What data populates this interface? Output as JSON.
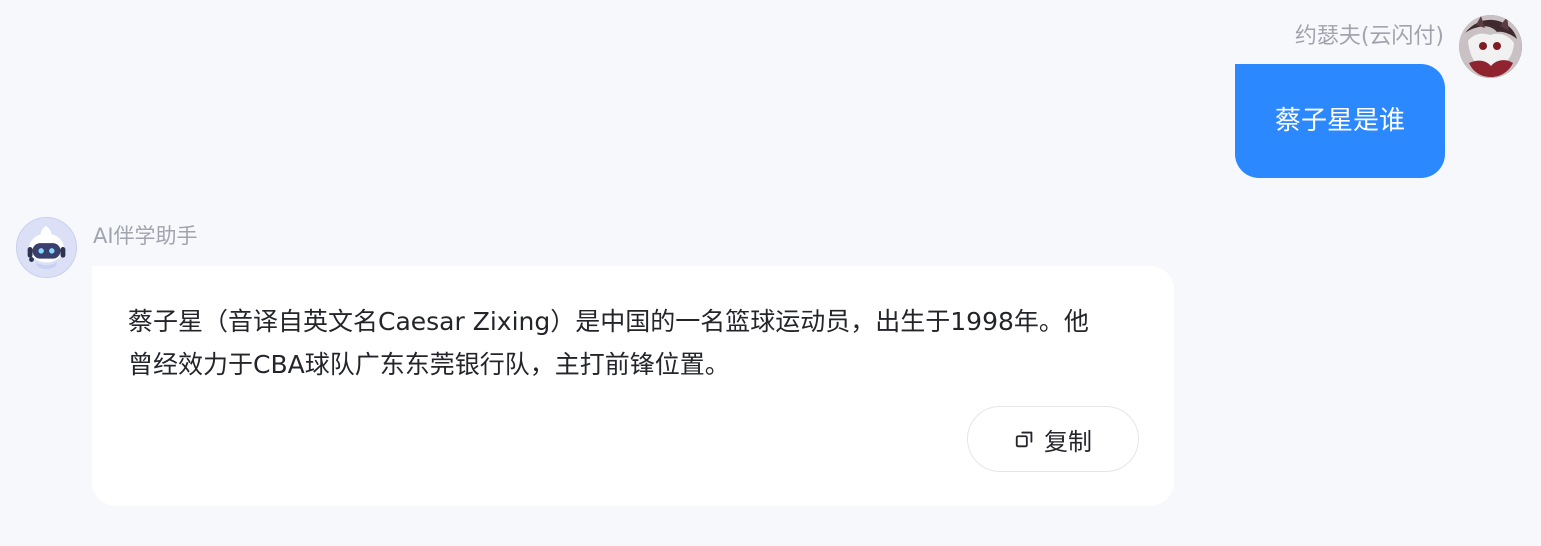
{
  "user": {
    "name": "约瑟夫(云闪付)",
    "message": "蔡子星是谁",
    "avatar_icon": "user-avatar-image"
  },
  "bot": {
    "name": "AI伴学助手",
    "avatar_icon": "robot-icon",
    "message": "蔡子星（音译自英文名Caesar Zixing）是中国的一名篮球运动员，出生于1998年。他曾经效力于CBA球队广东东莞银行队，主打前锋位置。",
    "copy_label": "复制",
    "copy_icon": "copy-icon"
  },
  "colors": {
    "page_bg": "#f7f8fc",
    "user_bubble": "#2b88ff",
    "bot_bubble": "#ffffff",
    "muted_text": "#a1a4ad",
    "main_text": "#23252b"
  }
}
